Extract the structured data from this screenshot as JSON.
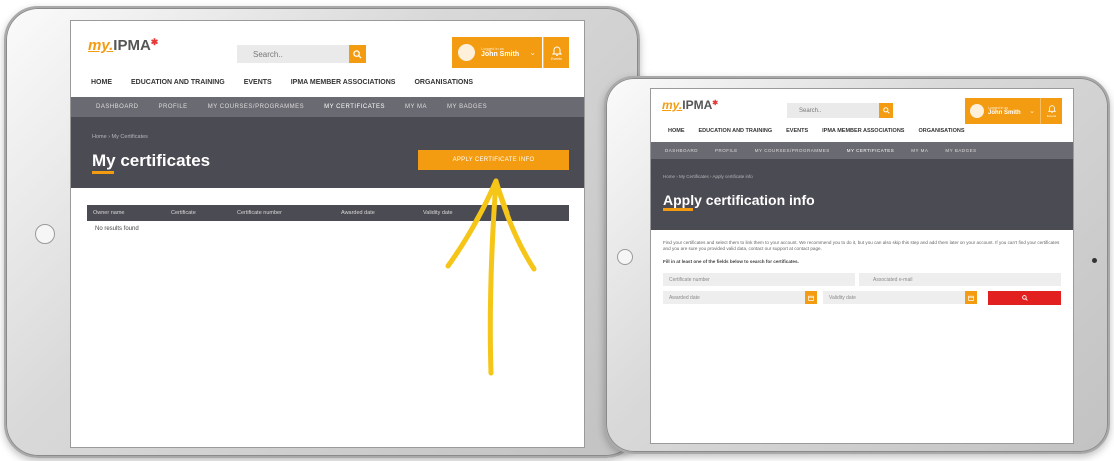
{
  "left_tablet": {
    "logo": {
      "my": "my.",
      "ipma": "IPMA",
      "star": "✱"
    },
    "search": {
      "placeholder": "Search..",
      "icon": "search-icon"
    },
    "user": {
      "logged_as": "Logged in as",
      "name": "John Smith",
      "chevron": "⌄"
    },
    "bell": {
      "icon": "bell-icon",
      "label": "Events"
    },
    "main_nav": [
      "HOME",
      "EDUCATION AND TRAINING",
      "EVENTS",
      "IPMA MEMBER ASSOCIATIONS",
      "ORGANISATIONS"
    ],
    "sub_nav": [
      "DASHBOARD",
      "PROFILE",
      "MY COURSES/PROGRAMMES",
      "MY CERTIFICATES",
      "MY MA",
      "MY BADGES"
    ],
    "breadcrumb": "Home  ›  My Certificates",
    "page_title": "My certificates",
    "apply_button": "APPLY CERTIFICATE INFO",
    "table_headers": [
      "Owner name",
      "Certificate",
      "Certificate number",
      "Awarded date",
      "Validity date"
    ],
    "empty_text": "No results found"
  },
  "right_tablet": {
    "logo": {
      "my": "my.",
      "ipma": "IPMA",
      "star": "✱"
    },
    "search": {
      "placeholder": "Search..",
      "icon": "search-icon"
    },
    "user": {
      "logged_as": "Logged in as",
      "name": "John Smith",
      "chevron": "⌄"
    },
    "bell": {
      "icon": "bell-icon",
      "label": "Events"
    },
    "main_nav": [
      "HOME",
      "EDUCATION AND TRAINING",
      "EVENTS",
      "IPMA MEMBER ASSOCIATIONS",
      "ORGANISATIONS"
    ],
    "sub_nav": [
      "DASHBOARD",
      "PROFILE",
      "MY COURSES/PROGRAMMES",
      "MY CERTIFICATES",
      "MY MA",
      "MY BADGES"
    ],
    "breadcrumb": "Home  ›  My Certificates  ›  Apply certificate info",
    "page_title": "Apply certification info",
    "intro": "Find your certificates and select them to link them to your account. We recommend you to do it, but you can also skip this step and add them later on your account. If you can't find your certificates and you are sure you provided valid data, contact our support at contact page.",
    "fill_note": "Fill in at least one of the fields below to search for certificates.",
    "fields": {
      "certificate_number": "Certificate number",
      "associated_email": "Associated e-mail",
      "awarded_date": "Awarded date",
      "validity_date": "Validity date"
    },
    "calendar_icon": "calendar-icon",
    "search_icon": "search-icon"
  },
  "colors": {
    "accent": "#f39c12",
    "dark_banner": "#4b4b53",
    "subnav": "#6a6a72",
    "search_red": "#e32020",
    "arrow": "#f5c518"
  }
}
